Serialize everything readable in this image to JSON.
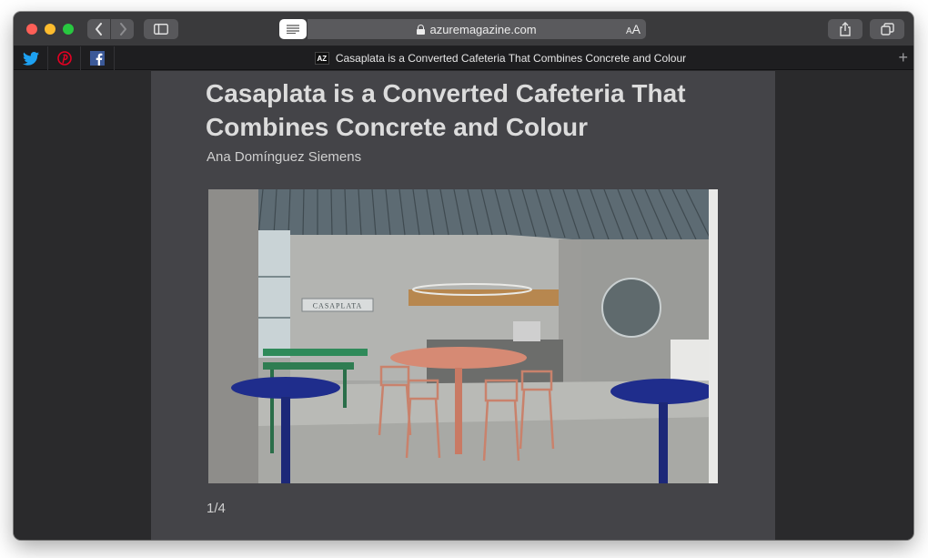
{
  "browser": {
    "url": "azuremagazine.com",
    "text_size_small": "A",
    "text_size_large": "A",
    "tab_title": "Casaplata is a Converted Cafeteria That Combines Concrete and Colour",
    "site_badge": "AZ",
    "new_tab": "+"
  },
  "favorites": [
    {
      "name": "Twitter",
      "icon": "twitter-icon",
      "color": "#1da1f2"
    },
    {
      "name": "Pinterest",
      "icon": "pinterest-icon",
      "color": "#e60023"
    },
    {
      "name": "Facebook",
      "icon": "facebook-icon",
      "color": "#3b5998"
    }
  ],
  "article": {
    "title": "Casaplata is a Converted Cafeteria That Combines Concrete and Colour",
    "author": "Ana Domínguez Siemens",
    "image_counter": "1/4",
    "image_sign_text": "CASAPLATA"
  },
  "colors": {
    "traffic_red": "#fe5f57",
    "traffic_yellow": "#febc2e",
    "traffic_green": "#28c840",
    "reader_bg": "#444448"
  }
}
